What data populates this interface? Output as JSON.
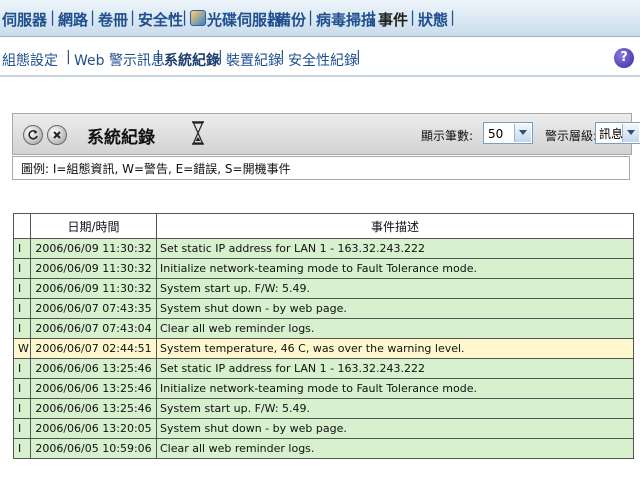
{
  "nav": {
    "items": [
      {
        "label": "伺服器",
        "active": false
      },
      {
        "label": "網路",
        "active": false
      },
      {
        "label": "卷冊",
        "active": false
      },
      {
        "label": "安全性",
        "active": false
      },
      {
        "label": "光碟伺服器",
        "active": false
      },
      {
        "label": "備份",
        "active": false
      },
      {
        "label": "病毒掃描",
        "active": false
      },
      {
        "label": "事件",
        "active": true
      },
      {
        "label": "狀態",
        "active": false
      }
    ]
  },
  "subnav": {
    "items": [
      {
        "label": "組態設定",
        "active": false
      },
      {
        "label": "Web 警示訊息",
        "active": false
      },
      {
        "label": "系統紀錄",
        "active": true
      },
      {
        "label": "裝置紀錄",
        "active": false
      },
      {
        "label": "安全性紀錄",
        "active": false
      }
    ],
    "help_label": "?"
  },
  "panel": {
    "title": "系統紀錄",
    "count_label": "顯示筆數:",
    "count_value": "50",
    "level_label": "警示層級:",
    "level_value": "訊息"
  },
  "legend": "圖例: I=組態資訊, W=警告, E=錯誤, S=開機事件",
  "table": {
    "headers": [
      "",
      "日期/時間",
      "事件描述"
    ],
    "rows": [
      {
        "type": "I",
        "date": "2006/06/09 11:30:32",
        "desc": "Set static IP address for LAN 1 - 163.32.243.222"
      },
      {
        "type": "I",
        "date": "2006/06/09 11:30:32",
        "desc": "Initialize network-teaming mode to Fault Tolerance mode."
      },
      {
        "type": "I",
        "date": "2006/06/09 11:30:32",
        "desc": "System start up. F/W: 5.49."
      },
      {
        "type": "I",
        "date": "2006/06/07 07:43:35",
        "desc": "System shut down - by web page."
      },
      {
        "type": "I",
        "date": "2006/06/07 07:43:04",
        "desc": "Clear all web reminder logs."
      },
      {
        "type": "W",
        "date": "2006/06/07 02:44:51",
        "desc": "System temperature, 46 C, was over the warning level."
      },
      {
        "type": "I",
        "date": "2006/06/06 13:25:46",
        "desc": "Set static IP address for LAN 1 - 163.32.243.222"
      },
      {
        "type": "I",
        "date": "2006/06/06 13:25:46",
        "desc": "Initialize network-teaming mode to Fault Tolerance mode."
      },
      {
        "type": "I",
        "date": "2006/06/06 13:25:46",
        "desc": "System start up. F/W: 5.49."
      },
      {
        "type": "I",
        "date": "2006/06/06 13:20:05",
        "desc": "System shut down - by web page."
      },
      {
        "type": "I",
        "date": "2006/06/05 10:59:06",
        "desc": "Clear all web reminder logs."
      }
    ]
  },
  "colors": {
    "info_row": "#d7f0cd",
    "warn_row": "#fff8cf",
    "nav_text": "#1f4f8f"
  }
}
